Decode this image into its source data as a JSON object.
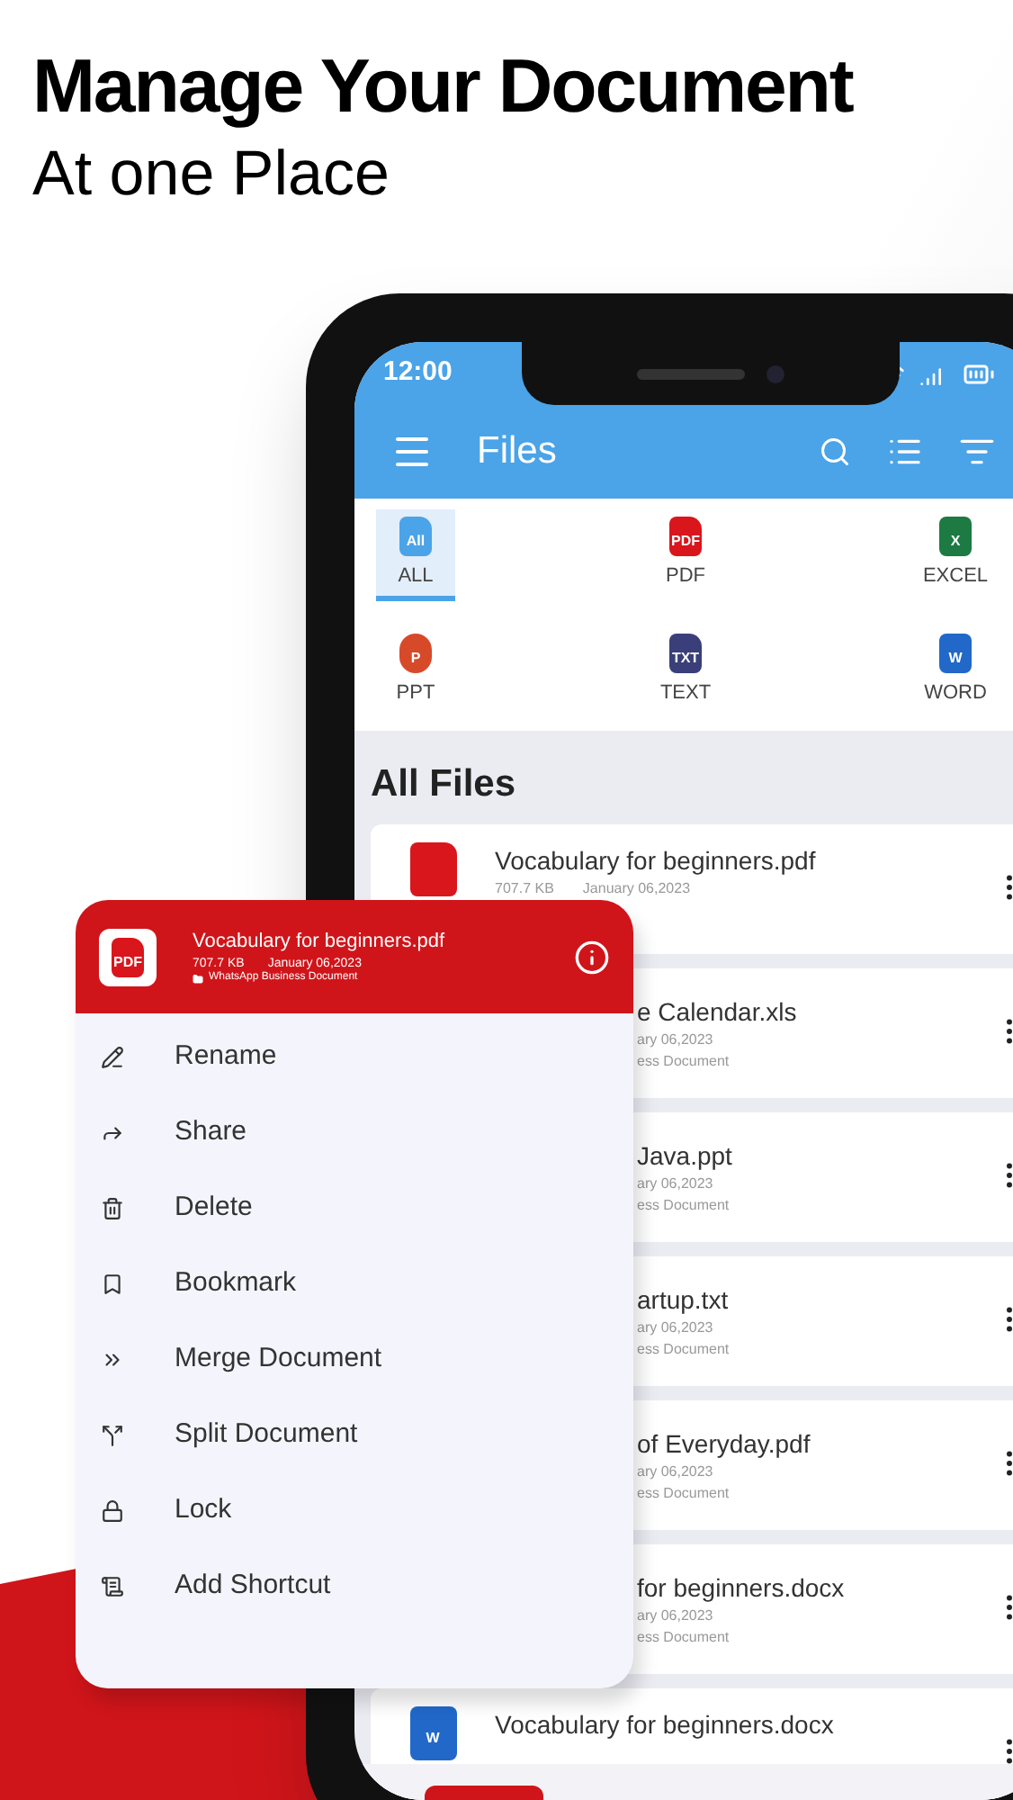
{
  "headline": {
    "title": "Manage Your Document",
    "subtitle": "At one Place"
  },
  "status_bar": {
    "time": "12:00"
  },
  "app_bar": {
    "title": "Files"
  },
  "categories": [
    {
      "label": "ALL",
      "icon_text": "All",
      "kind": "all",
      "selected": true
    },
    {
      "label": "PDF",
      "icon_text": "PDF",
      "kind": "pdf",
      "selected": false
    },
    {
      "label": "EXCEL",
      "icon_text": "X",
      "kind": "excel",
      "selected": false
    },
    {
      "label": "PPT",
      "icon_text": "P",
      "kind": "ppt",
      "selected": false
    },
    {
      "label": "TEXT",
      "icon_text": "TXT",
      "kind": "text",
      "selected": false
    },
    {
      "label": "WORD",
      "icon_text": "W",
      "kind": "word",
      "selected": false
    }
  ],
  "section_title": "All Files",
  "files": [
    {
      "name": "Vocabulary for beginners.pdf",
      "size": "707.7 KB",
      "date": "January 06,2023",
      "icon": {
        "kind": "pdf"
      },
      "covered": false
    },
    {
      "name": "e Calendar.xls",
      "date": "ary 06,2023",
      "source": "ess Document",
      "covered": true
    },
    {
      "name": "Java.ppt",
      "date": "ary 06,2023",
      "source": "ess Document",
      "covered": true
    },
    {
      "name": "artup.txt",
      "date": "ary 06,2023",
      "source": "ess Document",
      "covered": true
    },
    {
      "name": "of Everyday.pdf",
      "date": "ary 06,2023",
      "source": "ess Document",
      "covered": true
    },
    {
      "name": "for beginners.docx",
      "date": "ary 06,2023",
      "source": "ess Document",
      "covered": true
    },
    {
      "name": "Vocabulary for beginners.docx",
      "icon": {
        "kind": "word",
        "text": "W"
      },
      "covered": false
    }
  ],
  "context_menu": {
    "file": {
      "name": "Vocabulary for beginners.pdf",
      "size": "707.7 KB",
      "date": "January 06,2023",
      "source": "WhatsApp Business Document",
      "icon_text": "PDF"
    },
    "items": [
      {
        "label": "Rename",
        "kind": "rename"
      },
      {
        "label": "Share",
        "kind": "share"
      },
      {
        "label": "Delete",
        "kind": "delete"
      },
      {
        "label": "Bookmark",
        "kind": "bookmark"
      },
      {
        "label": "Merge Document",
        "kind": "merge"
      },
      {
        "label": "Split Document",
        "kind": "split"
      },
      {
        "label": "Lock",
        "kind": "lock"
      },
      {
        "label": "Add Shortcut",
        "kind": "shortcut"
      }
    ]
  }
}
